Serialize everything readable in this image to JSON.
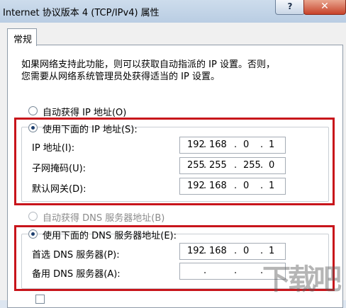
{
  "window": {
    "title": "Internet 协议版本 4 (TCP/IPv4) 属性",
    "help": "?",
    "close": "✕"
  },
  "tab": {
    "label": "常规"
  },
  "intro": {
    "line1": "如果网络支持此功能，则可以获取自动指派的 IP 设置。否则，",
    "line2": "您需要从网络系统管理员处获得适当的 IP 设置。"
  },
  "ip_section": {
    "auto_label": "自动获得 IP 地址(O)",
    "manual_label": "使用下面的 IP 地址(S):",
    "fields": [
      {
        "label": "IP 地址(I):",
        "octets": [
          "192",
          "168",
          "0",
          "1"
        ]
      },
      {
        "label": "子网掩码(U):",
        "octets": [
          "255",
          "255",
          "255",
          "0"
        ]
      },
      {
        "label": "默认网关(D):",
        "octets": [
          "192",
          "168",
          "0",
          "1"
        ]
      }
    ]
  },
  "dns_section": {
    "auto_label": "自动获得 DNS 服务器地址(B)",
    "manual_label": "使用下面的 DNS 服务器地址(E):",
    "fields": [
      {
        "label": "首选 DNS 服务器(P):",
        "octets": [
          "192",
          "168",
          "0",
          "1"
        ]
      },
      {
        "label": "备用 DNS 服务器(A):",
        "octets": [
          "",
          "",
          "",
          ""
        ]
      }
    ]
  },
  "watermark": "下载吧",
  "colors": {
    "highlight": "#c8151b",
    "selected_radio": "#1c3e6e"
  }
}
